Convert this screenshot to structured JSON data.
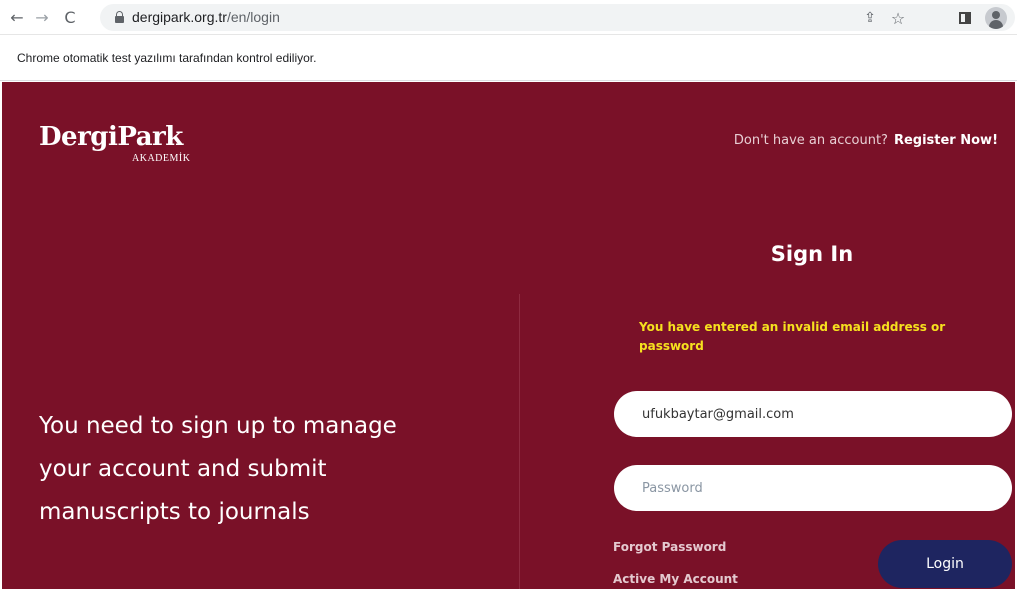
{
  "browser": {
    "url_host": "dergipark.org.tr",
    "url_path": "/en/login",
    "back_icon": "←",
    "forward_icon": "→",
    "reload_icon": "C",
    "share_icon": "⇪",
    "star_icon": "☆",
    "infobar_text": "Chrome otomatik test yazılımı tarafından kontrol ediliyor."
  },
  "header": {
    "logo_main": "DergiPark",
    "logo_sub": "AKADEMİK",
    "register_prompt": "Don't have an account?",
    "register_link": "Register Now!"
  },
  "left": {
    "tagline": "You need to sign up to manage your account and submit manuscripts to journals"
  },
  "signin": {
    "title": "Sign In",
    "error": "You have entered an invalid email address or password",
    "email_value": "ufukbaytar@gmail.com",
    "password_placeholder": "Password",
    "forgot_label": "Forgot Password",
    "activate_label": "Active My Account",
    "login_label": "Login"
  },
  "colors": {
    "brand_bg": "#7a1128",
    "login_button": "#1e2560",
    "error_text": "#f6e11e"
  }
}
